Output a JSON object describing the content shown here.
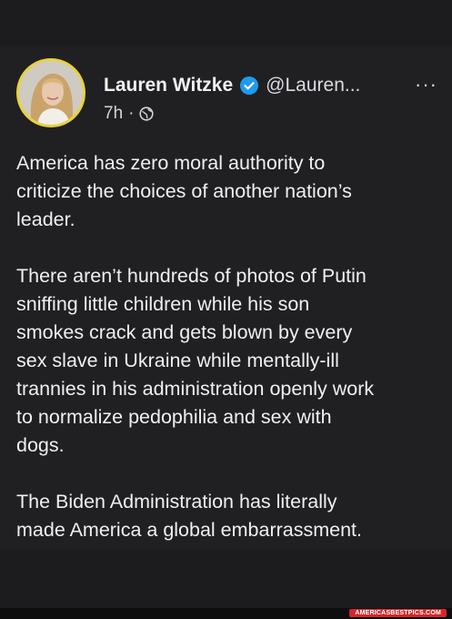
{
  "post": {
    "author_name": "Lauren Witzke",
    "handle": "@Lauren...",
    "time": "7h",
    "separator": "·",
    "more": "···",
    "paragraphs": [
      "America has zero moral authority to\ncriticize the choices of another nation’s\nleader.",
      "There aren’t hundreds of photos of Putin\nsniffing little children while his son\nsmokes crack and gets blown by every\nsex slave in Ukraine while mentally-ill\ntrannies in his administration openly work\nto normalize pedophilia and sex with\ndogs.",
      "The Biden Administration has literally\nmade America a global embarrassment."
    ]
  },
  "icons": {
    "verified": "verified-badge-icon",
    "audience": "globe-icon",
    "more": "more-options-icon"
  },
  "colors": {
    "background": "#202022",
    "verified": "#1d9bf0",
    "avatar_ring": "#e8d23a",
    "watermark": "#d6262b"
  },
  "watermark": {
    "text": "AMERICASBESTPICS.COM"
  }
}
